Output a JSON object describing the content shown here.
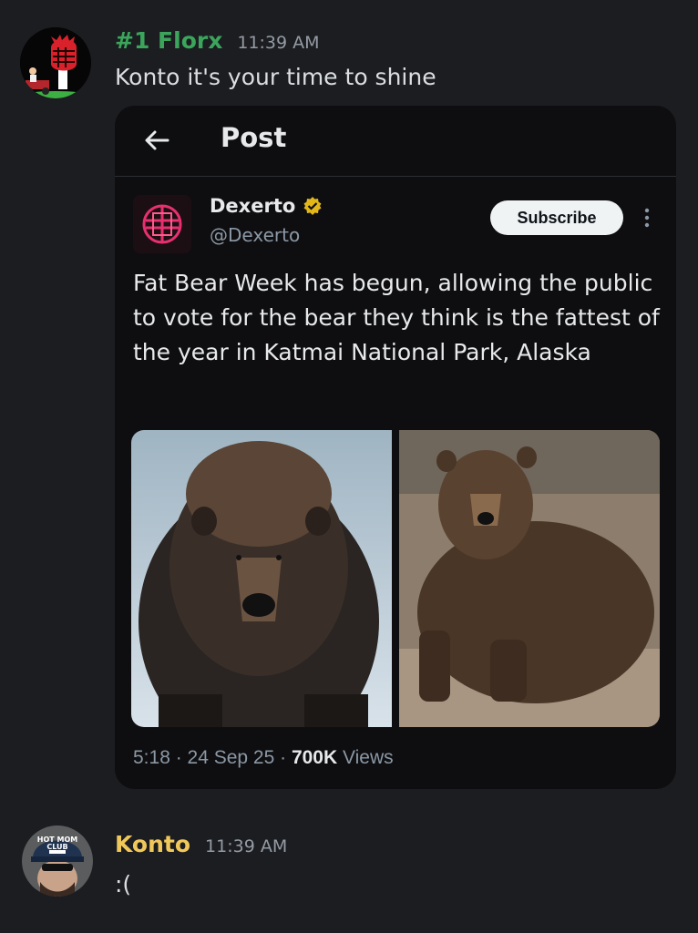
{
  "messages": [
    {
      "username": "#1 Florx",
      "username_color": "#3ba55c",
      "timestamp": "11:39 AM",
      "text": "Konto it's your time to shine",
      "avatar_icon": "red-fist-lawnmower-avatar"
    },
    {
      "username": "Konto",
      "username_color": "#f0c85a",
      "timestamp": "11:39 AM",
      "text": ":(",
      "avatar_icon": "hot-mom-club-cap-avatar",
      "avatar_cap_text": "HOT MOM CLUB"
    }
  ],
  "embed": {
    "title": "Post",
    "author_name": "Dexerto",
    "author_handle": "@Dexerto",
    "verified": true,
    "subscribe_label": "Subscribe",
    "text": "Fat Bear Week has begun, allowing the public to vote for the bear they think is the fattest of the year in Katmai National Park, Alaska",
    "images": [
      "fat-bear-in-snow-photo",
      "fat-bear-sitting-photo"
    ],
    "meta_time": "5:18 · 24 Sep 25 · ",
    "meta_views_count": "700K",
    "meta_views_label": " Views"
  }
}
